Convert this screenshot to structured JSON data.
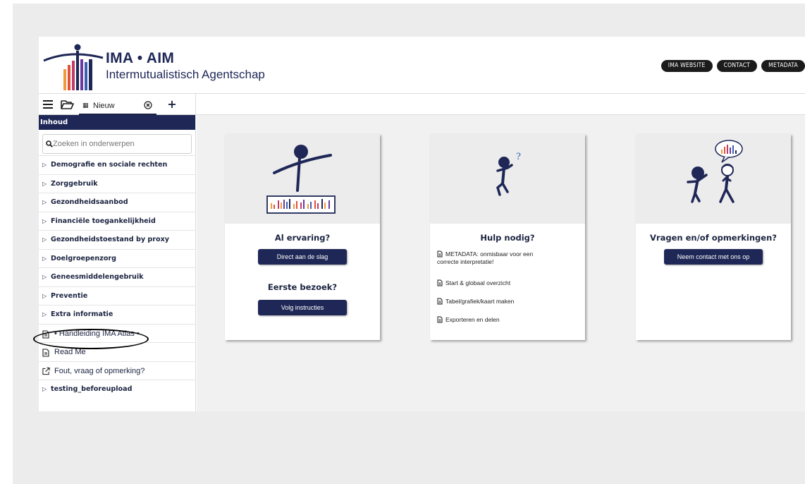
{
  "header": {
    "logo_line1": "IMA • AIM",
    "logo_line2": "Intermutualistisch Agentschap",
    "nav": [
      "IMA WEBSITE",
      "CONTACT",
      "METADATA"
    ]
  },
  "tabbar": {
    "tab_label": "Nieuw",
    "add_label": "+"
  },
  "sidebar": {
    "heading": "Inhoud",
    "search_placeholder": "Zoeken in onderwerpen",
    "items": [
      "Demografie en sociale rechten",
      "Zorggebruik",
      "Gezondheidsaanbod",
      "Financiële toegankelijkheid",
      "Gezondheidstoestand by proxy",
      "Doelgroepenzorg",
      "Geneesmiddelengebruik",
      "Preventie",
      "Extra informatie"
    ],
    "doc_items": [
      "• Handleiding IMA Atlas •",
      "Read Me",
      "Fout, vraag of opmerking?"
    ],
    "last_item": "testing_beforeupload"
  },
  "cards": {
    "experience": {
      "title": "Al ervaring?",
      "button": "Direct aan de slag",
      "title2": "Eerste bezoek?",
      "button2": "Volg instructies"
    },
    "help": {
      "title": "Hulp nodig?",
      "links": [
        "METADATA: onmisbaar voor een",
        "correcte interpretatie!",
        "Start & globaal overzicht",
        "Tabel/grafiek/kaart maken",
        "Exporteren en delen"
      ]
    },
    "questions": {
      "title": "Vragen en/of opmerkingen?",
      "button": "Neem contact met ons op"
    }
  },
  "colors": {
    "navy": "#1e2756",
    "logo_bars": [
      "#f29a3a",
      "#e0523a",
      "#c23b6a",
      "#6b3aa0",
      "#3a5fb0",
      "#1e2756"
    ]
  }
}
